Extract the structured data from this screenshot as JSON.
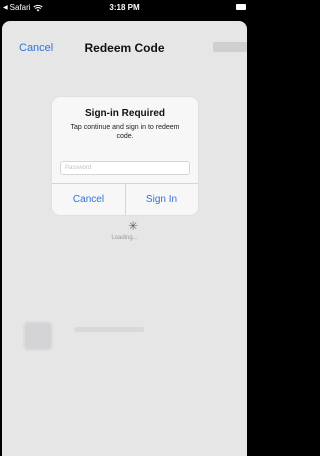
{
  "status_bar": {
    "back_app": "Safari",
    "time": "3:18 PM"
  },
  "nav": {
    "cancel_label": "Cancel",
    "title": "Redeem Code"
  },
  "background": {
    "loading_text": "Loading..."
  },
  "alert": {
    "title": "Sign-in Required",
    "message": "Tap continue and sign in to redeem code.",
    "password_placeholder": "Password",
    "cancel_label": "Cancel",
    "signin_label": "Sign In"
  },
  "colors": {
    "accent": "#2f72d8",
    "sheet": "#e6e6e7",
    "alert_bg": "#f7f7f8"
  }
}
